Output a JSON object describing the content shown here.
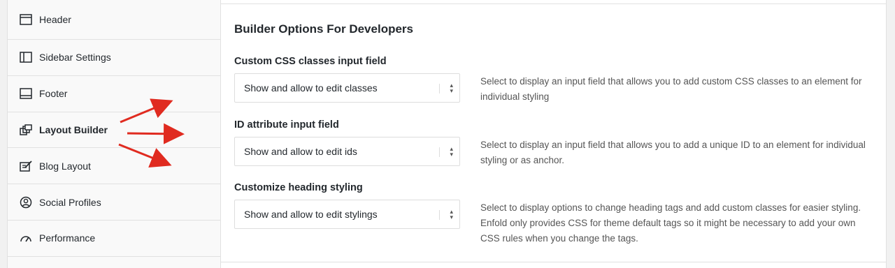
{
  "sidebar": {
    "items": [
      {
        "label": "Header",
        "icon": "header-layout-icon"
      },
      {
        "label": "Sidebar Settings",
        "icon": "sidebar-layout-icon"
      },
      {
        "label": "Footer",
        "icon": "footer-layout-icon"
      },
      {
        "label": "Layout Builder",
        "icon": "layout-builder-icon"
      },
      {
        "label": "Blog Layout",
        "icon": "blog-edit-icon"
      },
      {
        "label": "Social Profiles",
        "icon": "user-circle-icon"
      },
      {
        "label": "Performance",
        "icon": "gauge-icon"
      }
    ]
  },
  "main": {
    "title": "Builder Options For Developers",
    "options": [
      {
        "label": "Custom CSS classes input field",
        "select_value": "Show and allow to edit classes",
        "description": "Select to display an input field that allows you to add custom CSS classes to an element for individual styling"
      },
      {
        "label": "ID attribute input field",
        "select_value": "Show and allow to edit ids",
        "description": "Select to display an input field that allows you to add a unique ID to an element for individual styling or as anchor."
      },
      {
        "label": "Customize heading styling",
        "select_value": "Show and allow to edit stylings",
        "description": "Select to display options to change heading tags and add custom classes for easier styling. Enfold only provides CSS for theme default tags so it might be necessary to add your own CSS rules when you change the tags."
      }
    ]
  },
  "colors": {
    "annotation_arrow": "#e02b20"
  }
}
